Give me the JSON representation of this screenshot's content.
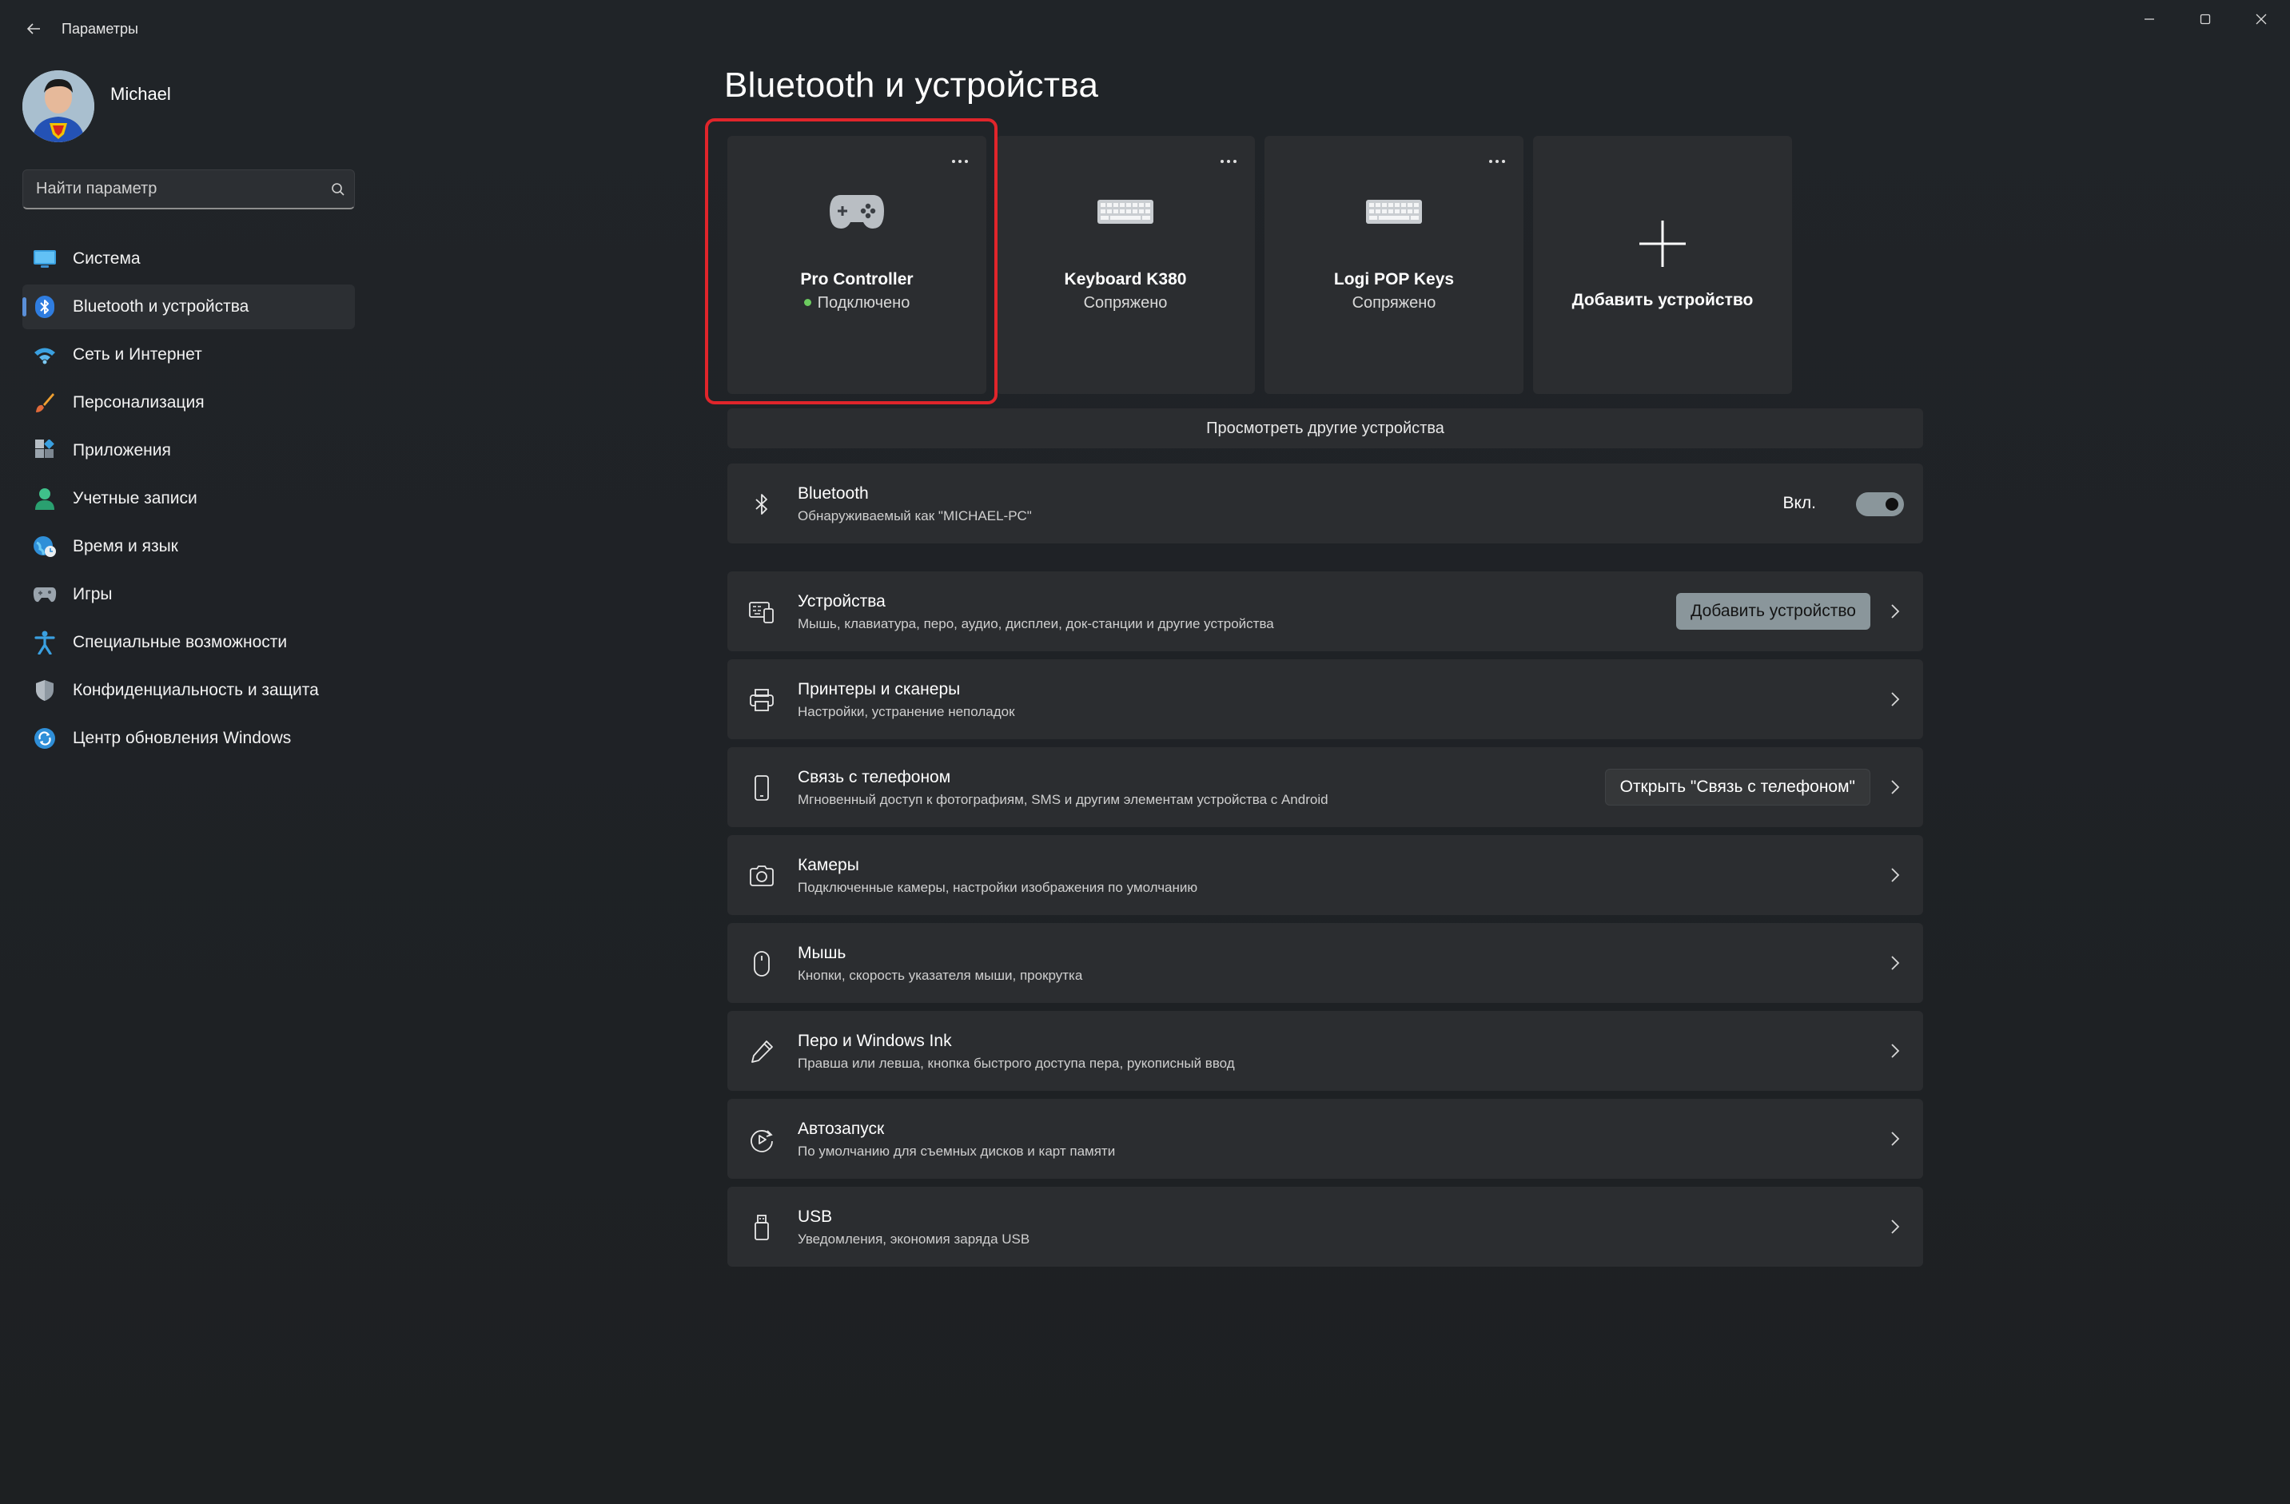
{
  "window": {
    "title": "Параметры"
  },
  "user": {
    "name": "Michael"
  },
  "search": {
    "placeholder": "Найти параметр"
  },
  "sidebar": {
    "items": [
      {
        "label": "Система",
        "icon": "monitor-icon"
      },
      {
        "label": "Bluetooth и устройства",
        "icon": "bluetooth-icon",
        "selected": true
      },
      {
        "label": "Сеть и Интернет",
        "icon": "wifi-icon"
      },
      {
        "label": "Персонализация",
        "icon": "brush-icon"
      },
      {
        "label": "Приложения",
        "icon": "apps-icon"
      },
      {
        "label": "Учетные записи",
        "icon": "person-icon"
      },
      {
        "label": "Время и язык",
        "icon": "globe-clock-icon"
      },
      {
        "label": "Игры",
        "icon": "gamepad-icon"
      },
      {
        "label": "Специальные возможности",
        "icon": "accessibility-icon"
      },
      {
        "label": "Конфиденциальность и защита",
        "icon": "shield-icon"
      },
      {
        "label": "Центр обновления Windows",
        "icon": "update-icon"
      }
    ]
  },
  "main": {
    "title": "Bluetooth и устройства",
    "devices": [
      {
        "name": "Pro Controller",
        "status": "Подключено",
        "connected": true,
        "icon": "gamepad-icon"
      },
      {
        "name": "Keyboard K380",
        "status": "Сопряжено",
        "connected": false,
        "icon": "keyboard-icon"
      },
      {
        "name": "Logi POP Keys",
        "status": "Сопряжено",
        "connected": false,
        "icon": "keyboard-icon"
      }
    ],
    "add_device_tile": "Добавить устройство",
    "view_more": "Просмотреть другие устройства",
    "bluetooth": {
      "title": "Bluetooth",
      "subtitle": "Обнаруживаемый как \"MICHAEL-PC\"",
      "toggle_label": "Вкл.",
      "enabled": true
    },
    "cards": [
      {
        "title": "Устройства",
        "subtitle": "Мышь, клавиатура, перо, аудио, дисплеи, док-станции и другие устройства",
        "button": "Добавить устройство",
        "icon": "devices-icon"
      },
      {
        "title": "Принтеры и сканеры",
        "subtitle": "Настройки, устранение неполадок",
        "icon": "printer-icon"
      },
      {
        "title": "Связь с телефоном",
        "subtitle": "Мгновенный доступ к фотографиям, SMS и другим элементам устройства с Android",
        "button": "Открыть \"Связь с телефоном\"",
        "icon": "phone-icon"
      },
      {
        "title": "Камеры",
        "subtitle": "Подключенные камеры, настройки изображения по умолчанию",
        "icon": "camera-icon"
      },
      {
        "title": "Мышь",
        "subtitle": "Кнопки, скорость указателя мыши, прокрутка",
        "icon": "mouse-icon"
      },
      {
        "title": "Перо и Windows Ink",
        "subtitle": "Правша или левша, кнопка быстрого доступа пера, рукописный ввод",
        "icon": "pen-icon"
      },
      {
        "title": "Автозапуск",
        "subtitle": "По умолчанию для съемных дисков и карт памяти",
        "icon": "autoplay-icon"
      },
      {
        "title": "USB",
        "subtitle": "Уведомления, экономия заряда USB",
        "icon": "usb-icon"
      }
    ]
  },
  "colors": {
    "accent": "#8a969b",
    "highlight": "#e0252b",
    "connected_dot": "#6ccb5f",
    "card_bg": "#2b2d30"
  }
}
